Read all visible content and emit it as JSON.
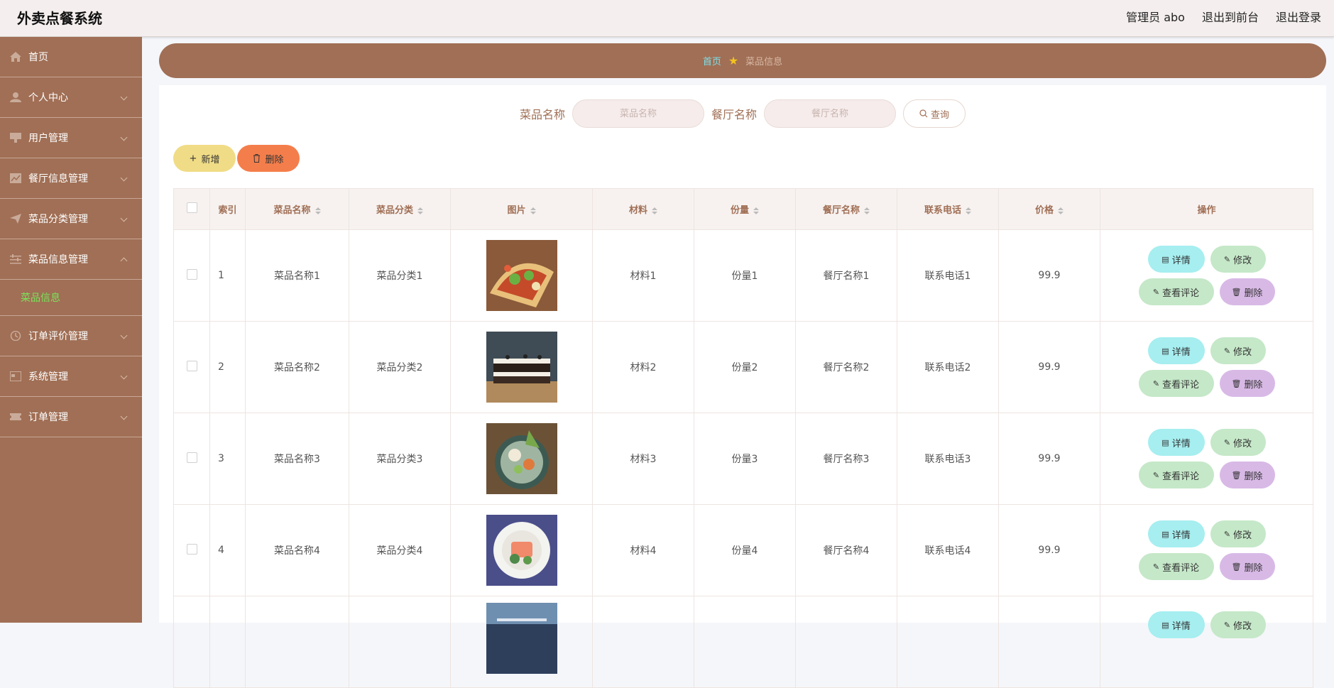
{
  "header": {
    "title": "外卖点餐系统",
    "admin": "管理员 abo",
    "to_front": "退出到前台",
    "logout": "退出登录"
  },
  "sidebar": {
    "items": [
      {
        "label": "首页"
      },
      {
        "label": "个人中心"
      },
      {
        "label": "用户管理"
      },
      {
        "label": "餐厅信息管理"
      },
      {
        "label": "菜品分类管理"
      },
      {
        "label": "菜品信息管理"
      },
      {
        "label": "订单评价管理"
      },
      {
        "label": "系统管理"
      },
      {
        "label": "订单管理"
      }
    ],
    "sub_active": "菜品信息"
  },
  "breadcrumb": {
    "home": "首页",
    "current": "菜品信息"
  },
  "search": {
    "dish_label": "菜品名称",
    "dish_placeholder": "菜品名称",
    "rest_label": "餐厅名称",
    "rest_placeholder": "餐厅名称",
    "query": "查询"
  },
  "actions": {
    "add": "新增",
    "delete": "删除"
  },
  "table": {
    "headers": [
      "索引",
      "菜品名称",
      "菜品分类",
      "图片",
      "材料",
      "份量",
      "餐厅名称",
      "联系电话",
      "价格",
      "操作"
    ],
    "rows": [
      {
        "idx": "1",
        "name": "菜品名称1",
        "cat": "菜品分类1",
        "mat": "材料1",
        "qty": "份量1",
        "rest": "餐厅名称1",
        "phone": "联系电话1",
        "price": "99.9"
      },
      {
        "idx": "2",
        "name": "菜品名称2",
        "cat": "菜品分类2",
        "mat": "材料2",
        "qty": "份量2",
        "rest": "餐厅名称2",
        "phone": "联系电话2",
        "price": "99.9"
      },
      {
        "idx": "3",
        "name": "菜品名称3",
        "cat": "菜品分类3",
        "mat": "材料3",
        "qty": "份量3",
        "rest": "餐厅名称3",
        "phone": "联系电话3",
        "price": "99.9"
      },
      {
        "idx": "4",
        "name": "菜品名称4",
        "cat": "菜品分类4",
        "mat": "材料4",
        "qty": "份量4",
        "rest": "餐厅名称4",
        "phone": "联系电话4",
        "price": "99.9"
      },
      {
        "idx": "",
        "name": "",
        "cat": "",
        "mat": "",
        "qty": "",
        "rest": "",
        "phone": "",
        "price": ""
      }
    ],
    "op_labels": {
      "detail": "详情",
      "edit": "修改",
      "comment": "查看评论",
      "delete": "删除"
    }
  }
}
